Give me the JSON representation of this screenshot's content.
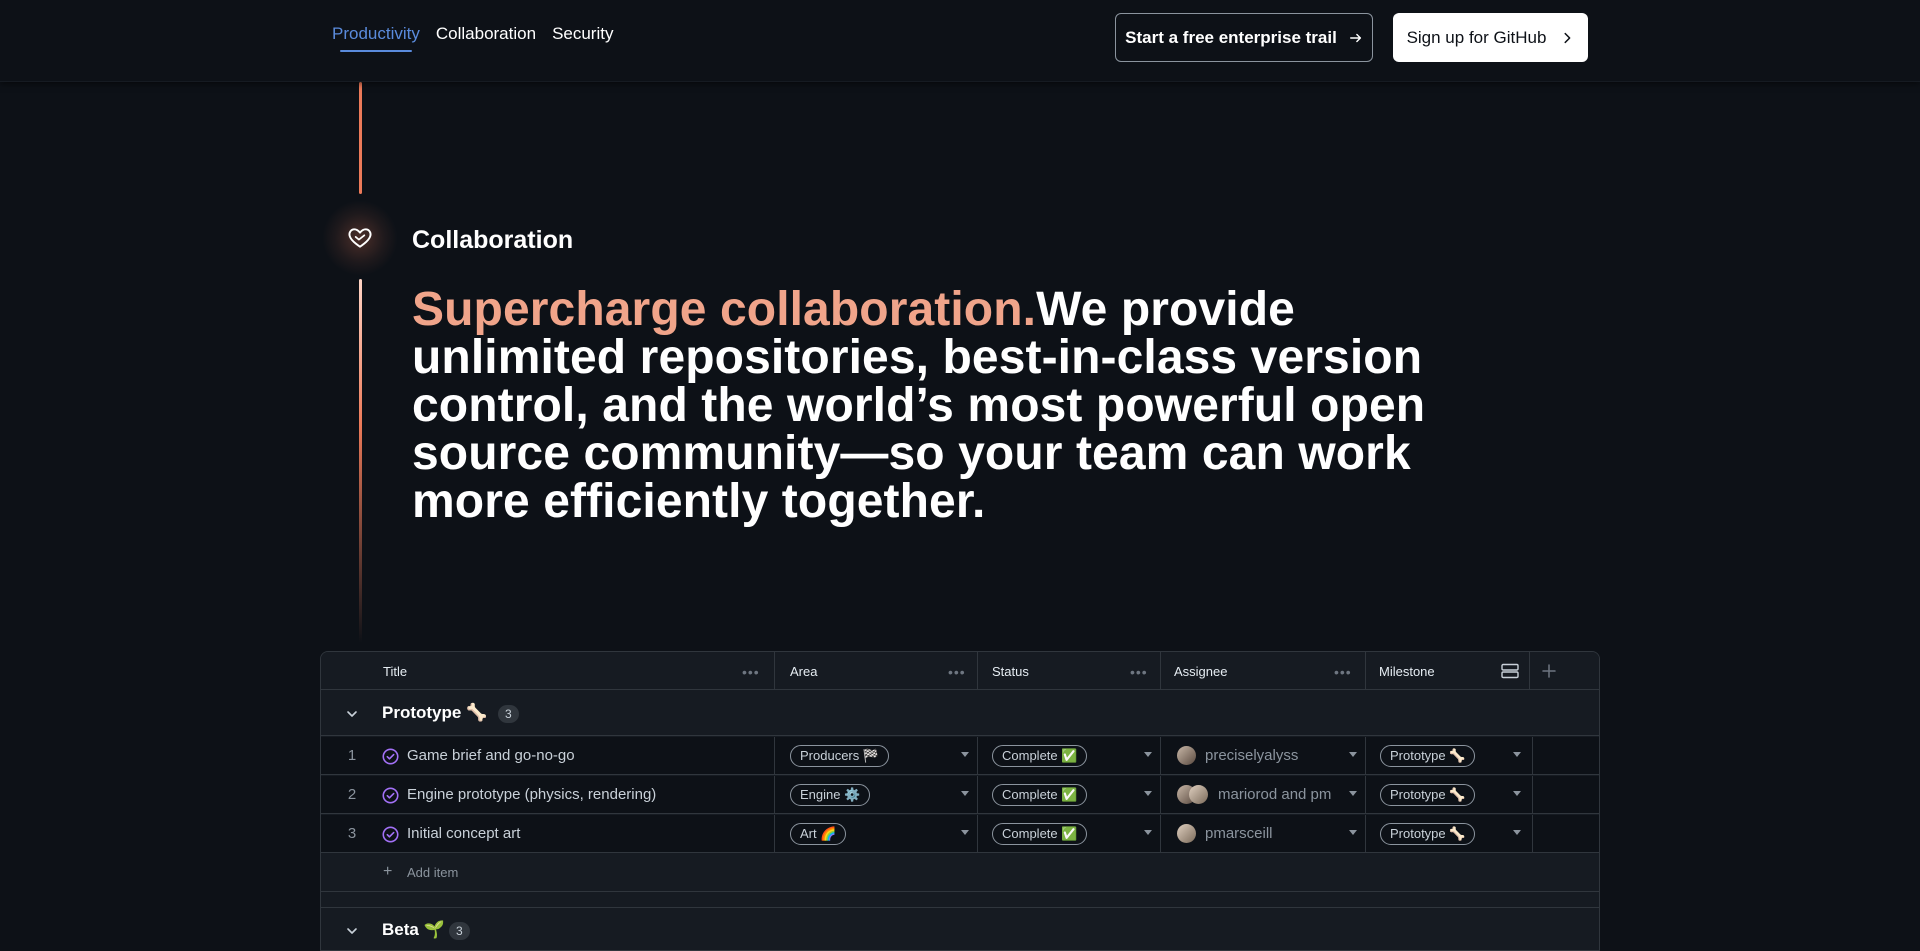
{
  "nav": {
    "tabs": [
      {
        "label": "Productivity",
        "active": true
      },
      {
        "label": "Collaboration",
        "active": false
      },
      {
        "label": "Security",
        "active": false
      }
    ],
    "enterprise_button": "Start a free enterprise trail",
    "signup_button": "Sign up for GitHub"
  },
  "hero": {
    "section_label": "Collaboration",
    "headline_accent": "Supercharge collaboration.",
    "headline_lines": [
      "We provide",
      "unlimited repositories, best-in-class version",
      "control, and the world’s most powerful open",
      "source community—so your team can work",
      "more efficiently together."
    ],
    "accent_color": "#f0a48a"
  },
  "table": {
    "columns": [
      "Title",
      "Area",
      "Status",
      "Assignee",
      "Milestone"
    ],
    "group": {
      "label": "Prototype 🦴",
      "count": "3"
    },
    "rows": [
      {
        "num": "1",
        "title": "Game brief and go-no-go",
        "area": "Producers 🏁",
        "status": "Complete ✅",
        "assignee": "preciselyalyss",
        "milestone": "Prototype 🦴"
      },
      {
        "num": "2",
        "title": "Engine prototype (physics, rendering)",
        "area": "Engine ⚙️",
        "status": "Complete ✅",
        "assignee": "mariorod and pm",
        "milestone": "Prototype 🦴"
      },
      {
        "num": "3",
        "title": "Initial concept art",
        "area": "Art 🌈",
        "status": "Complete ✅",
        "assignee": "pmarsceill",
        "milestone": "Prototype 🦴"
      }
    ],
    "add_item": "Add item",
    "next_group": {
      "label": "Beta 🌱",
      "count": "3"
    }
  }
}
